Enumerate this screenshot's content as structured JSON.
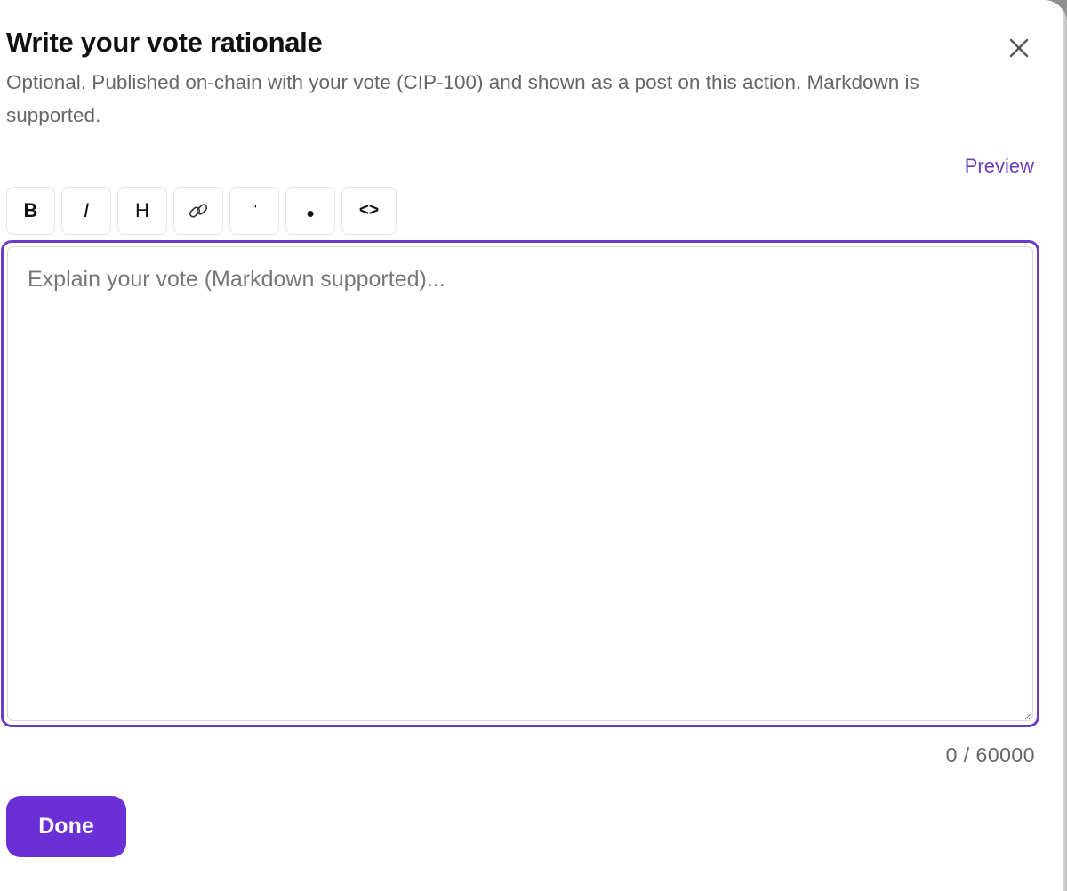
{
  "dialog": {
    "title": "Write your vote rationale",
    "subtitle": "Optional. Published on-chain with your vote (CIP-100) and shown as a post on this action. Markdown is supported.",
    "close_icon": "close-icon",
    "preview_label": "Preview"
  },
  "toolbar": {
    "buttons": [
      {
        "label": "B",
        "icon": "bold"
      },
      {
        "label": "I",
        "icon": "italic"
      },
      {
        "label": "H",
        "icon": "heading"
      },
      {
        "label": "🔗",
        "icon": "link-icon"
      },
      {
        "label": "\"",
        "icon": "quote"
      },
      {
        "label": "•",
        "icon": "bullet-list"
      },
      {
        "label": "<>",
        "icon": "code"
      }
    ]
  },
  "editor": {
    "value": "",
    "placeholder": "Explain your vote (Markdown supported)..."
  },
  "counter": {
    "text": "0 / 60000"
  },
  "actions": {
    "done_label": "Done"
  },
  "colors": {
    "accent": "#6a2fd6",
    "focus_border": "#6b3cc4",
    "link": "#6c3fb5"
  }
}
